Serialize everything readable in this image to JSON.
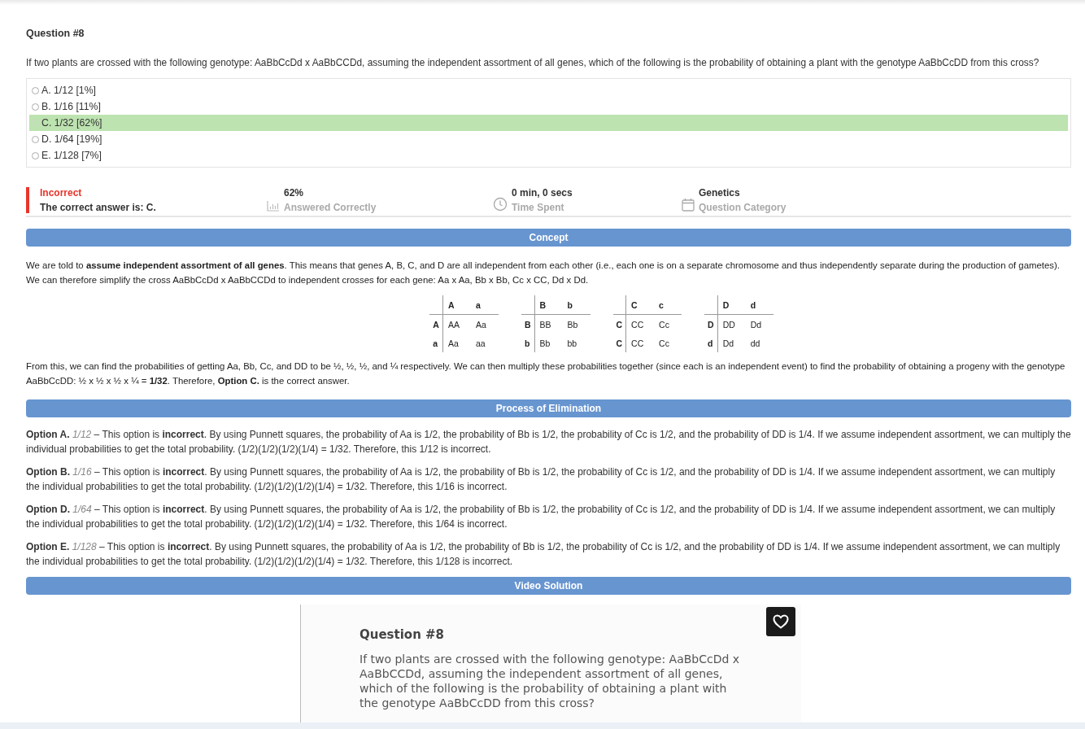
{
  "question": {
    "title": "Question #8",
    "text": "If two plants are crossed with the following genotype: AaBbCcDd x AaBbCCDd, assuming the independent assortment of all genes, which of the following is the probability of obtaining a plant with the genotype AaBbCcDD from this cross?"
  },
  "choices": [
    {
      "label": "A. 1/12 [1%]",
      "selected": false,
      "correct": false
    },
    {
      "label": "B. 1/16 [11%]",
      "selected": false,
      "correct": false
    },
    {
      "label": "C. 1/32 [62%]",
      "selected": false,
      "correct": true
    },
    {
      "label": "D. 1/64 [19%]",
      "selected": false,
      "correct": false
    },
    {
      "label": "E. 1/128 [7%]",
      "selected": false,
      "correct": false
    }
  ],
  "result": {
    "status": "Incorrect",
    "note": "The correct answer is: C.",
    "stats": [
      {
        "kind": "chart",
        "value": "62%",
        "label": "Answered Correctly"
      },
      {
        "kind": "clock",
        "value": "0 min, 0 secs",
        "label": "Time Spent"
      },
      {
        "kind": "calendar",
        "value": "Genetics",
        "label": "Question Category"
      }
    ]
  },
  "concept": {
    "heading": "Concept",
    "intro": "We are told to **assume independent assortment of all genes**. This means that genes A, B, C, and D are all independent from each other (i.e., each one is on a separate chromosome and thus independently separate during the production of gametes). We can therefore simplify the cross AaBbCcDd x AaBbCCDd to independent crosses for each gene: Aa x Aa, Bb x Bb, Cc x CC, Dd x Dd.",
    "squares": [
      {
        "header": [
          "A",
          "a"
        ],
        "rows": [
          {
            "label": "A",
            "cells": [
              "AA",
              "Aa"
            ]
          },
          {
            "label": "a",
            "cells": [
              "Aa",
              "aa"
            ]
          }
        ]
      },
      {
        "header": [
          "B",
          "b"
        ],
        "rows": [
          {
            "label": "B",
            "cells": [
              "BB",
              "Bb"
            ]
          },
          {
            "label": "b",
            "cells": [
              "Bb",
              "bb"
            ]
          }
        ]
      },
      {
        "header": [
          "C",
          "c"
        ],
        "rows": [
          {
            "label": "C",
            "cells": [
              "CC",
              "Cc"
            ]
          },
          {
            "label": "C",
            "cells": [
              "CC",
              "Cc"
            ]
          }
        ]
      },
      {
        "header": [
          "D",
          "d"
        ],
        "rows": [
          {
            "label": "D",
            "cells": [
              "DD",
              "Dd"
            ]
          },
          {
            "label": "d",
            "cells": [
              "Dd",
              "dd"
            ]
          }
        ]
      }
    ],
    "conclusion": "From this, we can find the probabilities of getting Aa, Bb, Cc, and DD to be ½, ½, ½, and ¼ respectively. We can then multiply these probabilities together (since each is an independent event) to find the probability of obtaining a progeny with the genotype AaBbCcDD: ½ x ½ x ½ x ¼ = **1/32**. Therefore, **Option C.** is the correct answer."
  },
  "elimination": {
    "heading": "Process of Elimination",
    "options": [
      "**Option A.** *1/12* – This option is **incorrect**. By using Punnett squares, the probability of Aa is 1/2, the probability of Bb is 1/2, the probability of Cc is 1/2, and the probability of DD is 1/4. If we assume independent assortment, we can multiply the individual probabilities to get the total probability. (1/2)(1/2)(1/2)(1/4) = 1/32. Therefore, this 1/12 is incorrect.",
      "**Option B.** *1/16* – This option is **incorrect**. By using Punnett squares, the probability of Aa is 1/2, the probability of Bb is 1/2, the probability of Cc is 1/2, and the probability of DD is 1/4. If we assume independent assortment, we can multiply the individual probabilities to get the total probability. (1/2)(1/2)(1/2)(1/4) = 1/32. Therefore, this 1/16 is incorrect.",
      "**Option D.** *1/64* – This option is **incorrect**. By using Punnett squares, the probability of Aa is 1/2, the probability of Bb is 1/2, the probability of Cc is 1/2, and the probability of DD is 1/4. If we assume independent assortment, we can multiply the individual probabilities to get the total probability. (1/2)(1/2)(1/2)(1/4) = 1/32. Therefore, this 1/64 is incorrect.",
      "**Option E.** *1/128* – This option is **incorrect**. By using Punnett squares, the probability of Aa is 1/2, the probability of Bb is 1/2, the probability of Cc is 1/2, and the probability of DD is 1/4. If we assume independent assortment, we can multiply the individual probabilities to get the total probability. (1/2)(1/2)(1/2)(1/4) = 1/32. Therefore, this 1/128 is incorrect."
    ]
  },
  "video": {
    "heading": "Video Solution",
    "title": "Question #8",
    "text": "If two plants are crossed with the following genotype: AaBbCcDd x AaBbCCDd, assuming the independent assortment of all genes, which of the following is the probability of obtaining a plant with the genotype AaBbCcDD from this cross?"
  }
}
